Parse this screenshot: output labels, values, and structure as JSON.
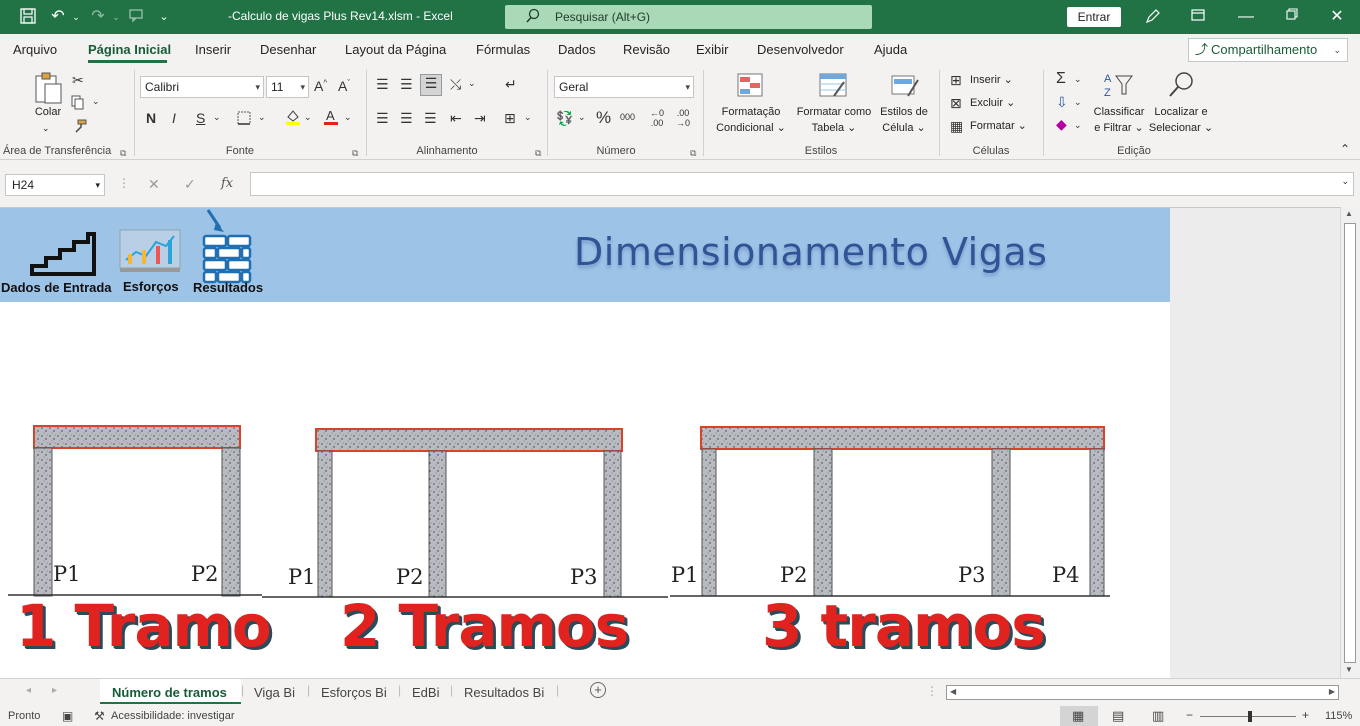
{
  "titlebar": {
    "doc_title": "-Calculo de vigas Plus Rev14.xlsm  -  Excel",
    "search_placeholder": "Pesquisar (Alt+G)",
    "signin_label": "Entrar"
  },
  "menu": {
    "tabs": [
      "Arquivo",
      "Página Inicial",
      "Inserir",
      "Desenhar",
      "Layout da Página",
      "Fórmulas",
      "Dados",
      "Revisão",
      "Exibir",
      "Desenvolvedor",
      "Ajuda"
    ],
    "share_label": "Compartilhamento"
  },
  "ribbon": {
    "clipboard": {
      "paste_label": "Colar",
      "group_label": "Área de Transferência"
    },
    "font": {
      "name": "Calibri",
      "size": "11",
      "bold": "N",
      "italic": "I",
      "underline": "S",
      "group_label": "Fonte"
    },
    "alignment": {
      "group_label": "Alinhamento"
    },
    "number": {
      "format": "Geral",
      "group_label": "Número"
    },
    "styles": {
      "conditional_1": "Formatação",
      "conditional_2": "Condicional",
      "table_1": "Formatar como",
      "table_2": "Tabela",
      "cell_1": "Estilos de",
      "cell_2": "Célula",
      "group_label": "Estilos"
    },
    "cells": {
      "insert": "Inserir",
      "delete": "Excluir",
      "format": "Formatar",
      "group_label": "Células"
    },
    "editing": {
      "sort_1": "Classificar",
      "sort_2": "e Filtrar",
      "find_1": "Localizar e",
      "find_2": "Selecionar",
      "group_label": "Edição"
    }
  },
  "formula_bar": {
    "name_box": "H24",
    "fx": "fx",
    "value": ""
  },
  "sheet": {
    "banner": {
      "title": "Dimensionamento Vigas",
      "nav": [
        "Dados de Entrada",
        "Esforços",
        "Resultados"
      ]
    },
    "diagrams": [
      {
        "title": "1 Tramo",
        "pillars": [
          "P1",
          "P2"
        ]
      },
      {
        "title": "2 Tramos",
        "pillars": [
          "P1",
          "P2",
          "P3"
        ]
      },
      {
        "title": "3 tramos",
        "pillars": [
          "P1",
          "P2",
          "P3",
          "P4"
        ]
      }
    ]
  },
  "sheet_tabs": [
    "Número de tramos",
    "Viga Bi",
    "Esforços Bi",
    "EdBi",
    "Resultados Bi"
  ],
  "status": {
    "ready": "Pronto",
    "accessibility": "Acessibilidade: investigar",
    "zoom": "115%"
  },
  "colors": {
    "excel_green": "#217346",
    "banner_blue": "#9dc3e6",
    "title_blue": "#2f5597",
    "beam_red": "#e0231e"
  }
}
